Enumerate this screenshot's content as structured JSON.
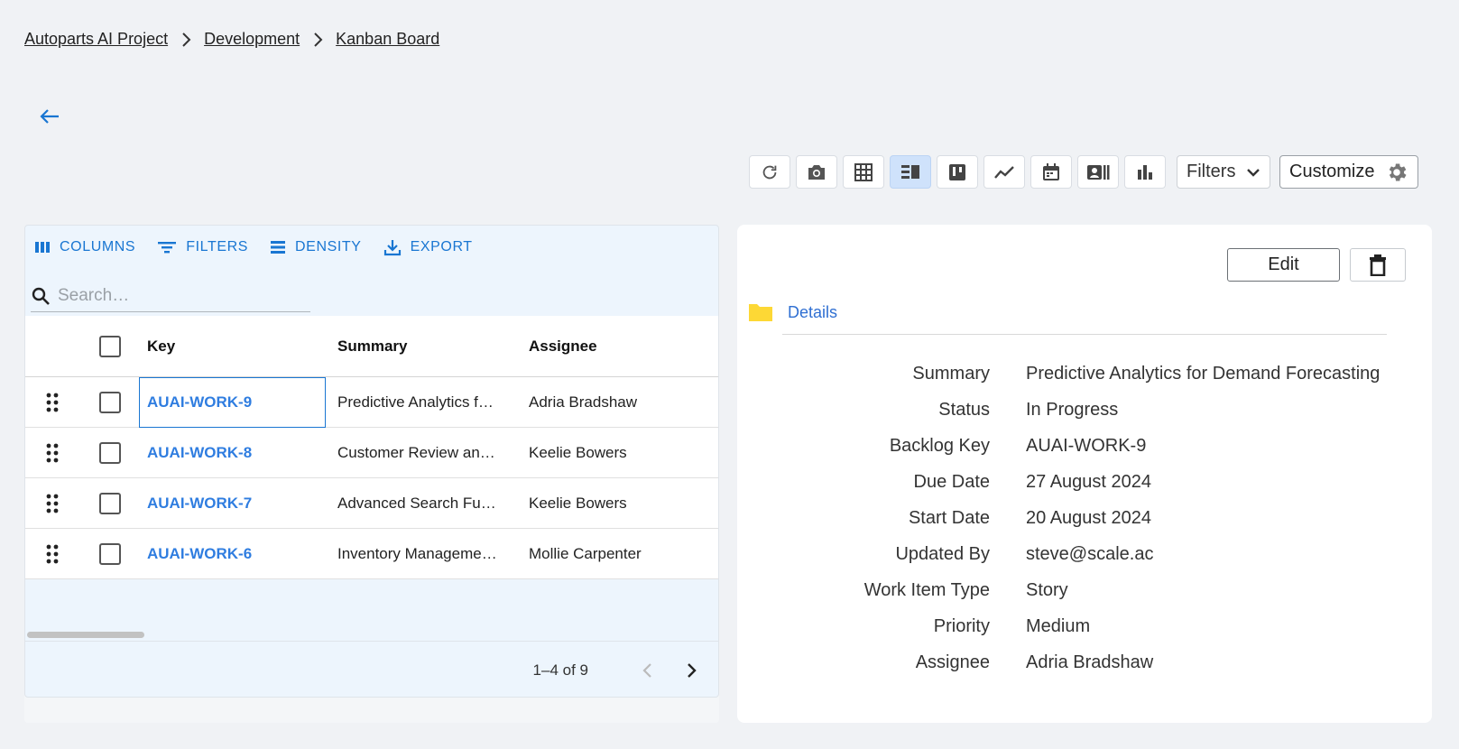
{
  "breadcrumb": {
    "items": [
      "Autoparts AI Project",
      "Development",
      "Kanban Board"
    ]
  },
  "toolbar": {
    "buttons": [
      {
        "name": "refresh-icon"
      },
      {
        "name": "camera-icon"
      },
      {
        "name": "grid-view-icon"
      },
      {
        "name": "list-detail-view-icon",
        "active": true
      },
      {
        "name": "kanban-view-icon"
      },
      {
        "name": "timeline-chart-icon"
      },
      {
        "name": "calendar-icon"
      },
      {
        "name": "card-view-icon"
      },
      {
        "name": "bar-chart-icon"
      }
    ],
    "filters_label": "Filters",
    "customize_label": "Customize"
  },
  "grid": {
    "tools": {
      "columns": "COLUMNS",
      "filters": "FILTERS",
      "density": "DENSITY",
      "export": "EXPORT"
    },
    "search_placeholder": "Search…",
    "headers": {
      "key": "Key",
      "summary": "Summary",
      "assignee": "Assignee"
    },
    "rows": [
      {
        "key": "AUAI-WORK-9",
        "summary": "Predictive Analytics f…",
        "assignee": "Adria Bradshaw"
      },
      {
        "key": "AUAI-WORK-8",
        "summary": "Customer Review an…",
        "assignee": "Keelie Bowers"
      },
      {
        "key": "AUAI-WORK-7",
        "summary": "Advanced Search Fu…",
        "assignee": "Keelie Bowers"
      },
      {
        "key": "AUAI-WORK-6",
        "summary": "Inventory Manageme…",
        "assignee": "Mollie Carpenter"
      }
    ],
    "pagination": "1–4 of 9"
  },
  "detail": {
    "edit_label": "Edit",
    "section_label": "Details",
    "fields": [
      {
        "label": "Summary",
        "value": "Predictive Analytics for Demand Forecasting"
      },
      {
        "label": "Status",
        "value": "In Progress"
      },
      {
        "label": "Backlog Key",
        "value": "AUAI-WORK-9"
      },
      {
        "label": "Due Date",
        "value": "27 August 2024"
      },
      {
        "label": "Start Date",
        "value": "20 August 2024"
      },
      {
        "label": "Updated By",
        "value": "steve@scale.ac"
      },
      {
        "label": "Work Item Type",
        "value": "Story"
      },
      {
        "label": "Priority",
        "value": "Medium"
      },
      {
        "label": "Assignee",
        "value": "Adria Bradshaw"
      }
    ]
  },
  "colors": {
    "accent": "#1976d2",
    "link": "#2f7de0",
    "folder": "#fdd835",
    "active_toolbar": "#cfe2fb"
  }
}
